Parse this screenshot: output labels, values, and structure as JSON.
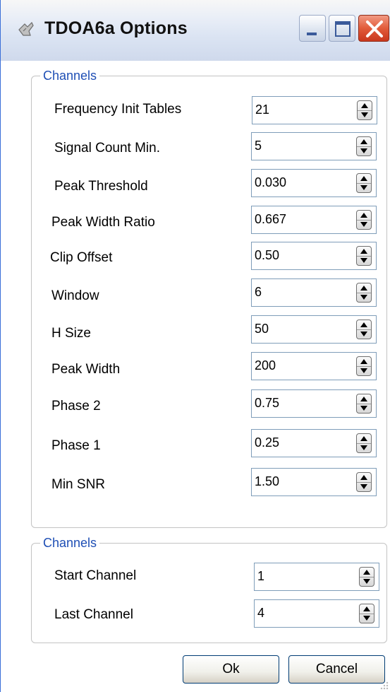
{
  "window": {
    "title": "TDOA6a Options",
    "app_icon": "hand-pointer-icon",
    "controls": [
      "minimize-icon",
      "maximize-icon",
      "close-icon"
    ]
  },
  "groups": [
    {
      "legend": "Channels",
      "fields": [
        {
          "label": "Frequency Init Tables",
          "value": "21"
        },
        {
          "label": "Signal Count Min.",
          "value": "5"
        },
        {
          "label": "Peak Threshold",
          "value": "0.030"
        },
        {
          "label": "Peak Width Ratio",
          "value": "0.667"
        },
        {
          "label": "Clip Offset",
          "value": "0.50"
        },
        {
          "label": "Window",
          "value": "6"
        },
        {
          "label": "H Size",
          "value": "50"
        },
        {
          "label": "Peak Width",
          "value": "200"
        },
        {
          "label": "Phase 2",
          "value": "0.75"
        },
        {
          "label": "Phase 1",
          "value": "0.25"
        },
        {
          "label": "Min SNR",
          "value": "1.50"
        }
      ]
    },
    {
      "legend": "Channels",
      "fields": [
        {
          "label": "Start Channel",
          "value": "1"
        },
        {
          "label": "Last Channel",
          "value": "4"
        }
      ]
    }
  ],
  "buttons": {
    "ok": "Ok",
    "cancel": "Cancel"
  },
  "colors": {
    "legend": "#1f4fb5",
    "close_button": "#e25b3a"
  }
}
